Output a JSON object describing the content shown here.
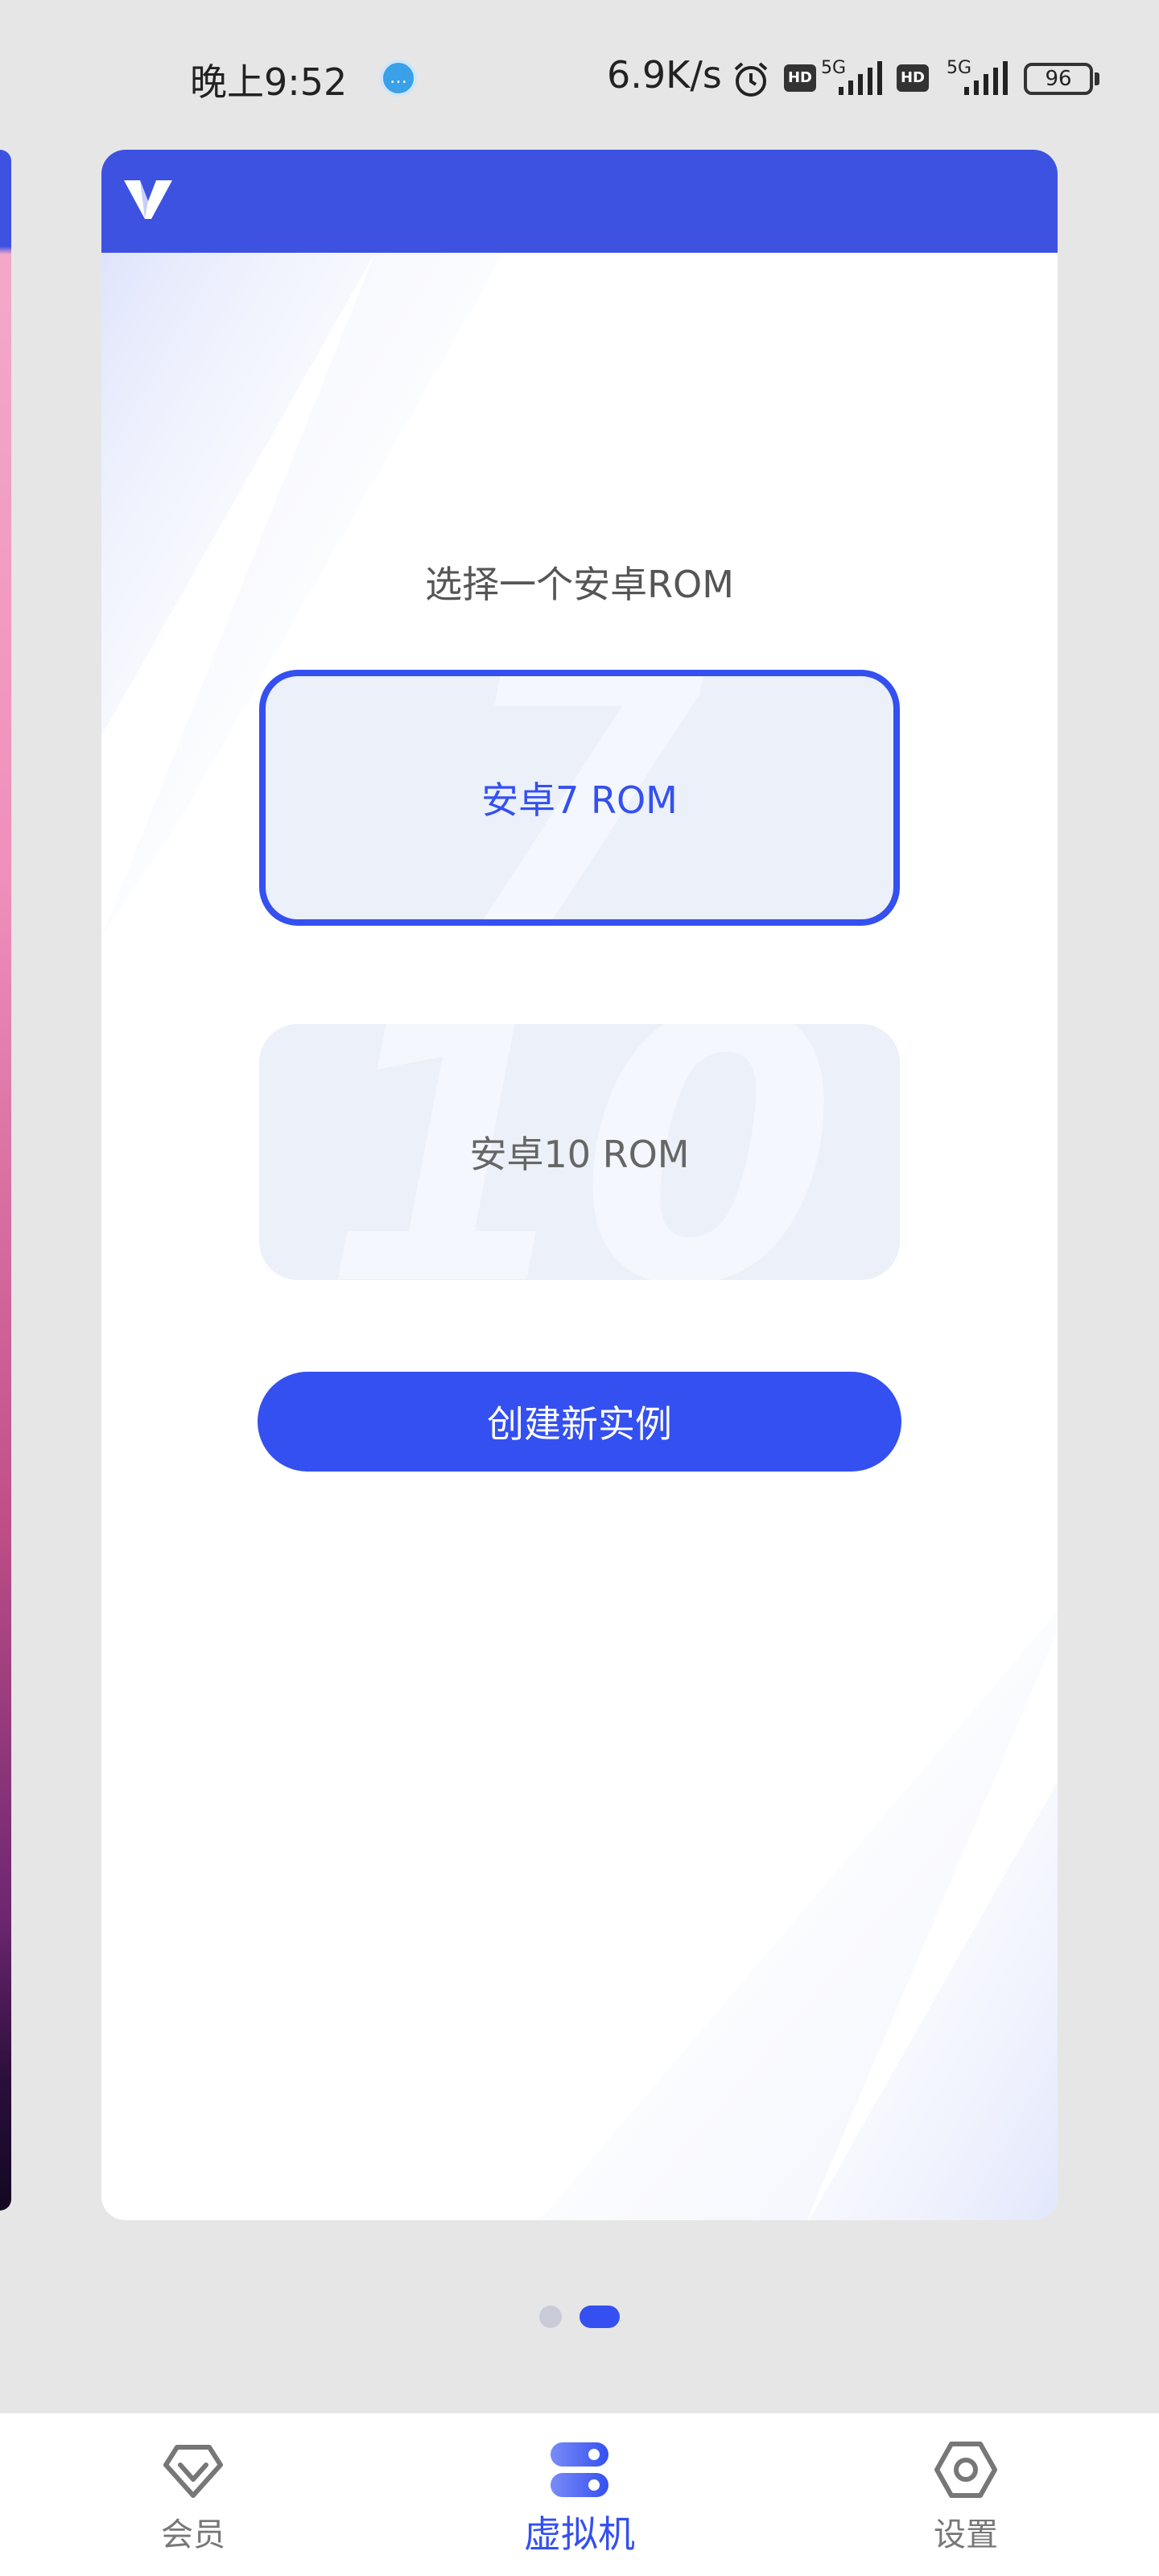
{
  "status_bar": {
    "time": "晚上9:52",
    "notification_icon": "chat-bubble-icon",
    "network_speed": "6.9K/s",
    "hd_label": "HD",
    "network_type": "5G",
    "battery": "96"
  },
  "card": {
    "title": "选择一个安卓ROM",
    "accent_color": "#3450f0",
    "header_color": "#3d52e0",
    "options": [
      {
        "label": "安卓7 ROM",
        "selected": true
      },
      {
        "label": "安卓10 ROM",
        "selected": false
      }
    ],
    "create_button_label": "创建新实例"
  },
  "pager": {
    "current_page": 2,
    "total_pages": 2
  },
  "bottom_nav": {
    "items": [
      {
        "label": "会员",
        "icon": "diamond-icon",
        "active": false
      },
      {
        "label": "虚拟机",
        "icon": "server-toggle-icon",
        "active": true
      },
      {
        "label": "设置",
        "icon": "hexagon-gear-icon",
        "active": false
      }
    ]
  }
}
